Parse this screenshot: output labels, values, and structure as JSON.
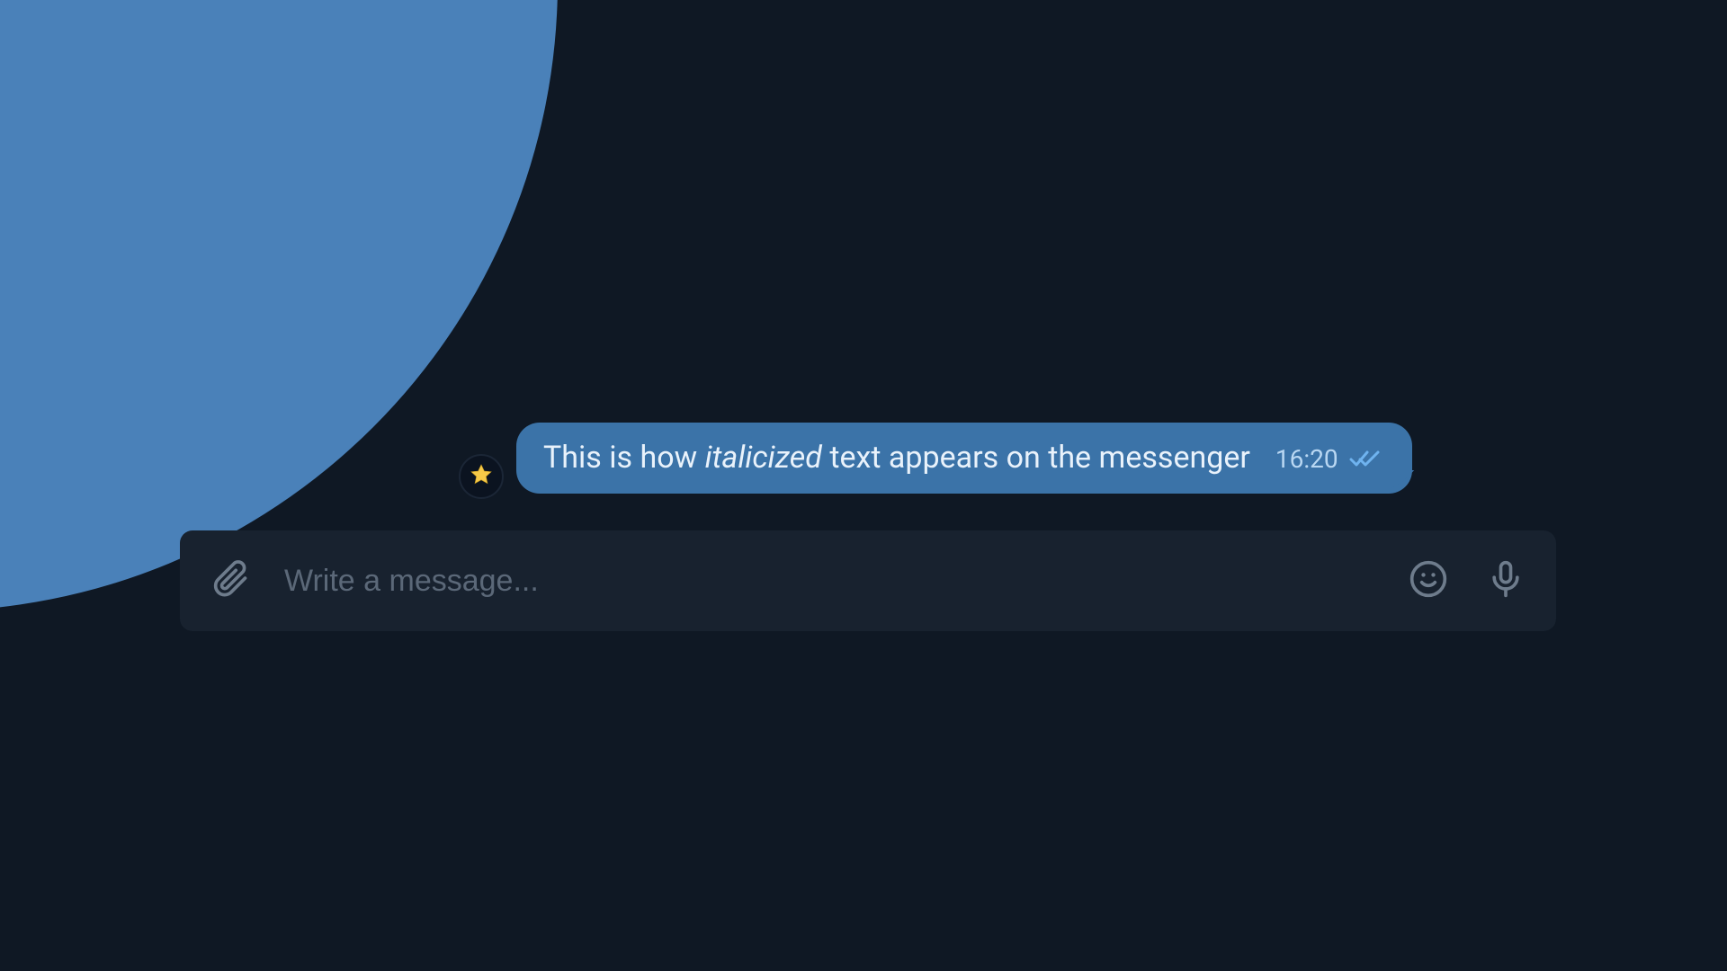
{
  "message": {
    "text_pre": "This is how ",
    "text_italic": "italicized",
    "text_post": " text appears on the messenger",
    "time": "16:20",
    "status": "read"
  },
  "composer": {
    "placeholder": "Write a message..."
  },
  "icons": {
    "star": "star-icon",
    "attach": "attach-icon",
    "emoji": "emoji-icon",
    "mic": "mic-icon",
    "read_checks": "double-check-icon"
  },
  "colors": {
    "bg": "#0f1824",
    "arc": "#4a81b9",
    "bubble": "#3b73a8",
    "time": "#b9d7f2",
    "input_bar": "#18222f",
    "placeholder": "#5b6878",
    "icon": "#6e7c8c"
  }
}
